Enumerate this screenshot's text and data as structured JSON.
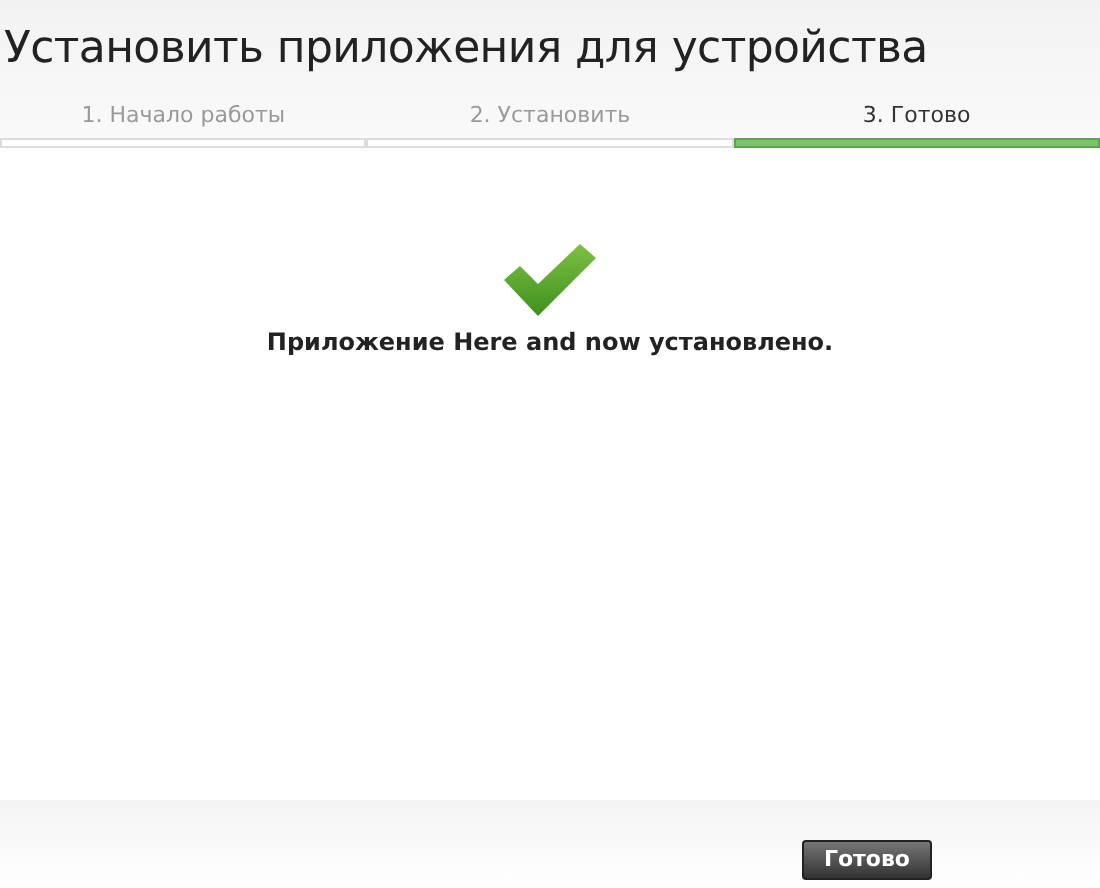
{
  "window": {
    "title": "Установить приложения для устройства"
  },
  "steps": [
    {
      "label": "1. Начало работы",
      "selected": false
    },
    {
      "label": "2. Установить",
      "selected": false
    },
    {
      "label": "3. Готово",
      "selected": true
    }
  ],
  "message": "Приложение Here and now установлено.",
  "buttons": [
    "Готово"
  ]
}
